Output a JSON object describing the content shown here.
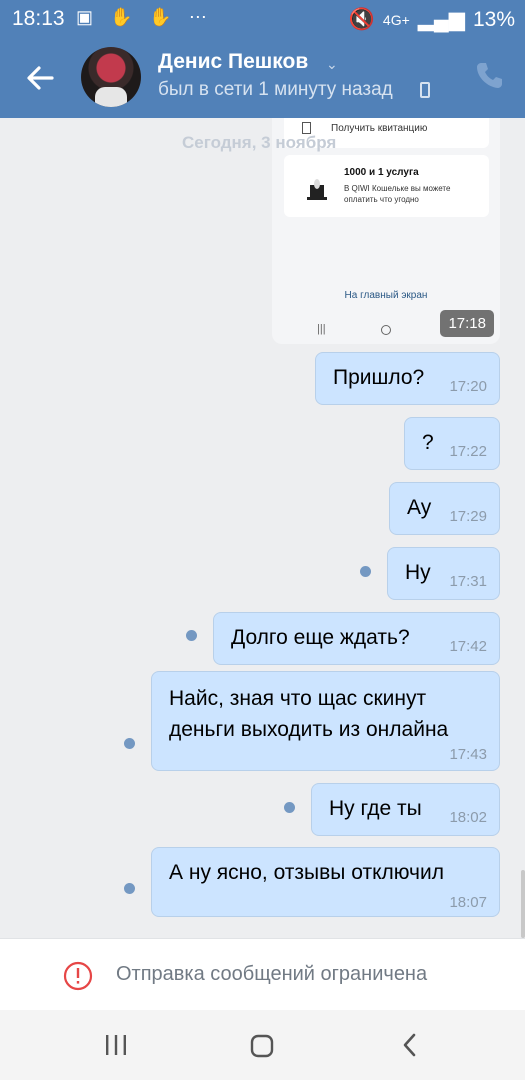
{
  "status_bar": {
    "time": "18:13",
    "network": "4G+",
    "battery": "13%"
  },
  "header": {
    "name": "Денис Пешков",
    "status": "был в сети 1 минуту назад"
  },
  "date_separator": "Сегодня, 3 ноября",
  "screenshot": {
    "row_label": "Получить квитанцию",
    "card_title": "1000 и 1 услуга",
    "card_desc": "В QIWI Кошельке вы можете оплатить что угодно",
    "link": "На главный экран",
    "time": "17:18"
  },
  "messages": [
    {
      "text": "Пришло?",
      "time": "17:20"
    },
    {
      "text": "?",
      "time": "17:22"
    },
    {
      "text": "Ау",
      "time": "17:29"
    },
    {
      "text": "Ну",
      "time": "17:31"
    },
    {
      "text": "Долго еще ждать?",
      "time": "17:42"
    },
    {
      "text": "Найс, зная что щас скинут деньги выходить из онлайна",
      "time": "17:43"
    },
    {
      "text": "Ну где ты",
      "time": "18:02"
    },
    {
      "text": "А ну ясно, отзывы отключил",
      "time": "18:07"
    }
  ],
  "restriction": {
    "text": "Отправка сообщений ограничена"
  },
  "colors": {
    "header": "#5181b8",
    "bubble": "#cce4ff",
    "unread_dot": "#7498c2",
    "warning": "#e64646"
  },
  "icons": [
    "back-arrow-icon",
    "chevron-down-icon",
    "phone-icon",
    "call-icon",
    "warning-icon",
    "recent-apps-icon",
    "home-icon",
    "back-icon"
  ]
}
